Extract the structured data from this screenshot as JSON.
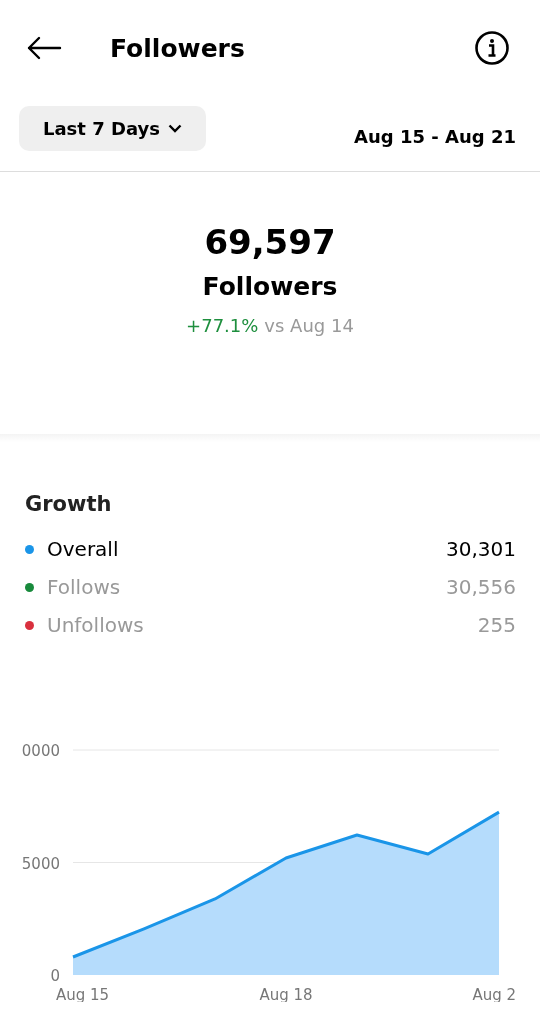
{
  "header": {
    "title": "Followers"
  },
  "filter": {
    "range_button": "Last 7 Days",
    "date_range": "Aug 15 - Aug 21"
  },
  "summary": {
    "count": "69,597",
    "label": "Followers",
    "change": "+77.1%",
    "comparison": "vs Aug 14"
  },
  "growth": {
    "title": "Growth",
    "items": [
      {
        "label": "Overall",
        "value": "30,301",
        "color": "#1a95e8",
        "selected": true
      },
      {
        "label": "Follows",
        "value": "30,556",
        "color": "#188a3c",
        "selected": false
      },
      {
        "label": "Unfollows",
        "value": "255",
        "color": "#d9303e",
        "selected": false
      }
    ],
    "chart": {
      "y_labels": [
        "0000",
        "5000",
        "0"
      ],
      "x_labels": [
        "Aug 15",
        "Aug 18",
        "Aug 2"
      ]
    }
  }
}
